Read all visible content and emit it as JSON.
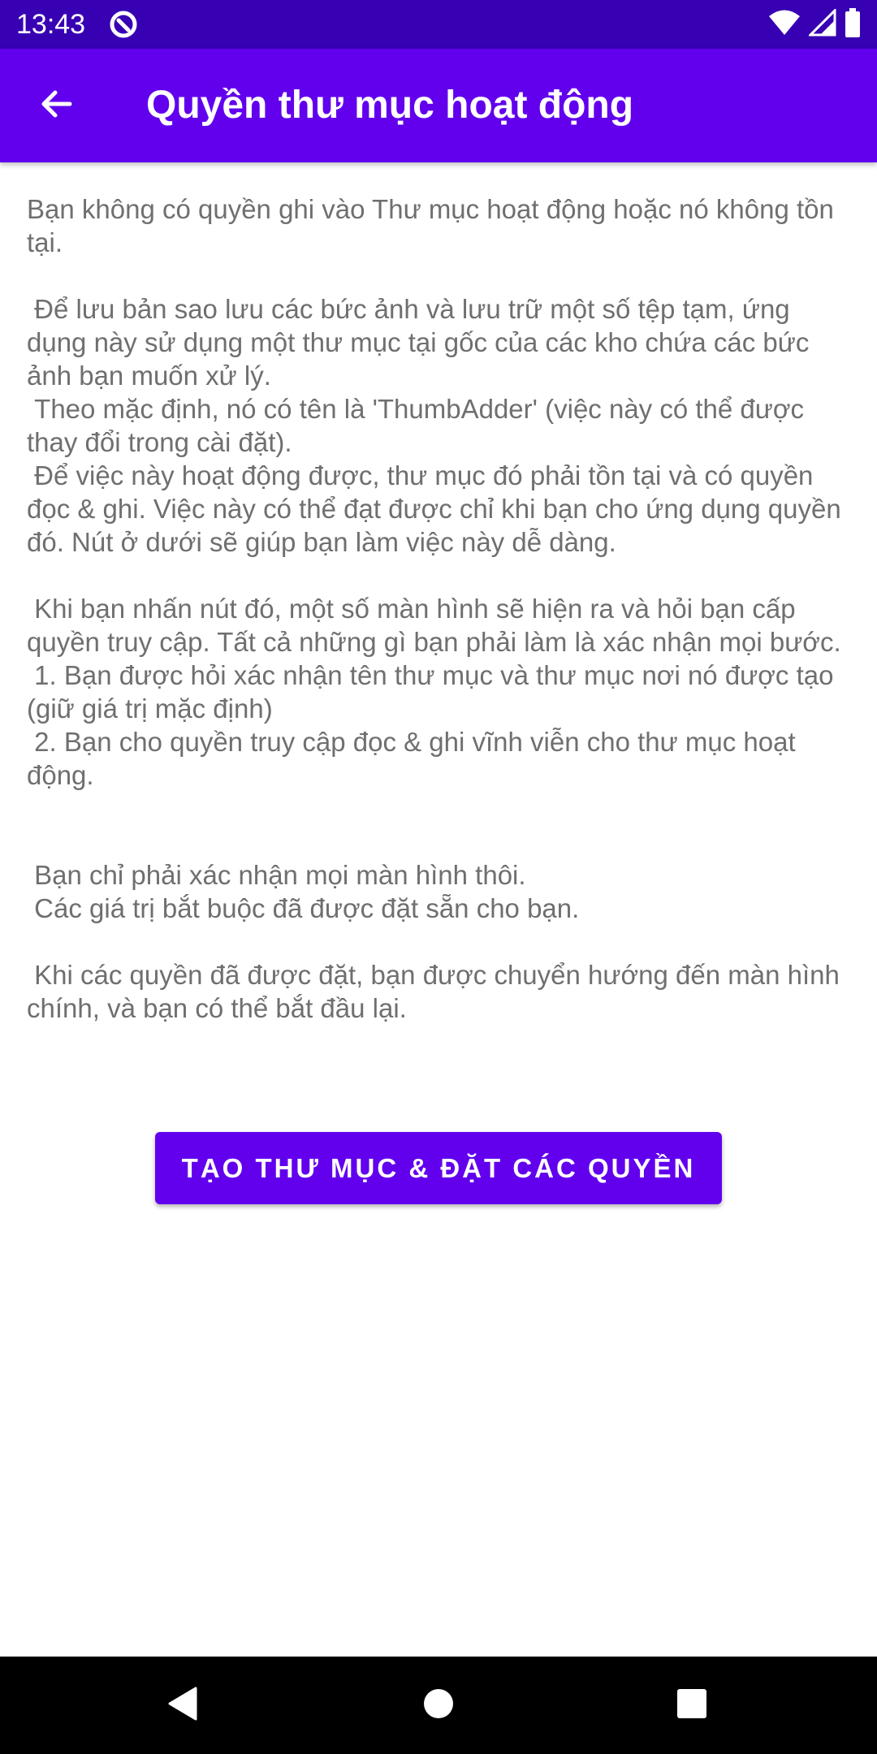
{
  "status_bar": {
    "time": "13:43",
    "icons": [
      "app-notification-icon",
      "wifi-icon",
      "signal-icon",
      "battery-icon"
    ]
  },
  "app_bar": {
    "title": "Quyền thư mục hoạt động",
    "back_icon": "arrow-back-icon",
    "color": "#6200ee"
  },
  "content": {
    "paragraphs": [
      "Bạn không có quyền ghi vào Thư mục hoạt động hoặc nó không tồn tại.",
      " Để lưu bản sao lưu các bức ảnh và lưu trữ một số tệp tạm, ứng dụng này sử dụng một thư mục tại gốc của các kho chứa các bức ảnh bạn muốn xử lý.\n Theo mặc định, nó có tên là 'ThumbAdder' (việc này có thể được thay đổi trong cài đặt).\n Để việc này hoạt động được, thư mục đó phải tồn tại và có quyền đọc & ghi. Việc này có thể đạt được chỉ khi bạn cho ứng dụng quyền đó. Nút ở dưới sẽ giúp bạn làm việc này dễ dàng.",
      " Khi bạn nhấn nút đó, một số màn hình sẽ hiện ra và hỏi bạn cấp quyền truy cập. Tất cả những gì bạn phải làm là xác nhận mọi bước.\n 1. Bạn được hỏi xác nhận tên thư mục và thư mục nơi nó được tạo (giữ giá trị mặc định)\n 2. Bạn cho quyền truy cập đọc & ghi vĩnh viễn cho thư mục hoạt động.",
      " Bạn chỉ phải xác nhận mọi màn hình thôi.\n Các giá trị bắt buộc đã được đặt sẵn cho bạn.",
      " Khi các quyền đã được đặt, bạn được chuyển hướng đến màn hình chính, và bạn có thể bắt đầu lại."
    ],
    "text_color": "#6f6f6f"
  },
  "action_button": {
    "label": "TẠO THƯ MỤC & ĐẶT CÁC QUYỀN"
  },
  "nav_bar": {
    "icons": [
      "nav-back-icon",
      "nav-home-icon",
      "nav-recents-icon"
    ]
  }
}
